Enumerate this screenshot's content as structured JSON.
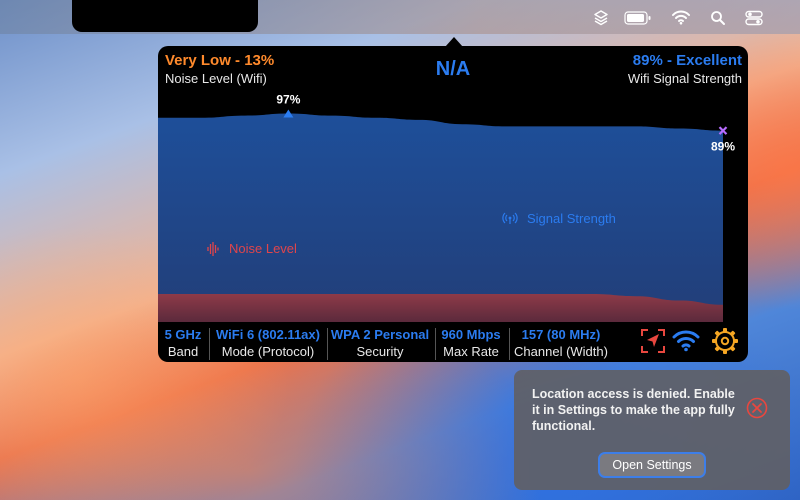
{
  "menubar": {
    "icons": [
      "layers-icon",
      "battery-icon",
      "wifi-icon",
      "search-icon",
      "control-center-icon"
    ]
  },
  "panel": {
    "noise": {
      "title": "Very Low - 13%",
      "subtitle": "Noise Level (Wifi)"
    },
    "center_value": "N/A",
    "signal": {
      "title": "89% - Excellent",
      "subtitle": "Wifi Signal Strength"
    },
    "chart": {
      "peak_label": "97%",
      "current_label": "89%",
      "signal_series_label": "Signal Strength",
      "noise_series_label": "Noise Level"
    },
    "stats": [
      {
        "value": "5 GHz",
        "label": "Band"
      },
      {
        "value": "WiFi 6 (802.11ax)",
        "label": "Mode (Protocol)"
      },
      {
        "value": "WPA 2 Personal",
        "label": "Security"
      },
      {
        "value": "960 Mbps",
        "label": "Max Rate"
      },
      {
        "value": "157 (80 MHz)",
        "label": "Channel (Width)"
      }
    ],
    "footer_icons": [
      "location-denied-icon",
      "wifi-icon",
      "settings-gear-icon"
    ]
  },
  "chart_data": {
    "type": "area",
    "title": "",
    "xlabel": "",
    "ylabel": "",
    "ylim": [
      0,
      100
    ],
    "series": [
      {
        "name": "Signal Strength",
        "values": [
          95,
          95,
          96,
          97,
          96,
          95,
          94,
          92,
          91,
          91,
          91,
          91,
          90,
          89
        ]
      },
      {
        "name": "Noise Level",
        "values": [
          13,
          13,
          13,
          13,
          13,
          13,
          13,
          13,
          13,
          13,
          13,
          12,
          10,
          8
        ]
      }
    ],
    "annotations": [
      {
        "text": "97%",
        "series": "Signal Strength",
        "marker": "triangle"
      },
      {
        "text": "89%",
        "series": "Signal Strength",
        "marker": "cross"
      }
    ]
  },
  "toast": {
    "message": "Location access is denied. Enable it in Settings to make the app fully functional.",
    "button": "Open Settings"
  },
  "colors": {
    "accent_blue": "#2b7cf0",
    "noise_orange": "#ff8a2c",
    "noise_red": "#e0454b",
    "gear_orange": "#f5a623",
    "close_red": "#e8473f"
  }
}
